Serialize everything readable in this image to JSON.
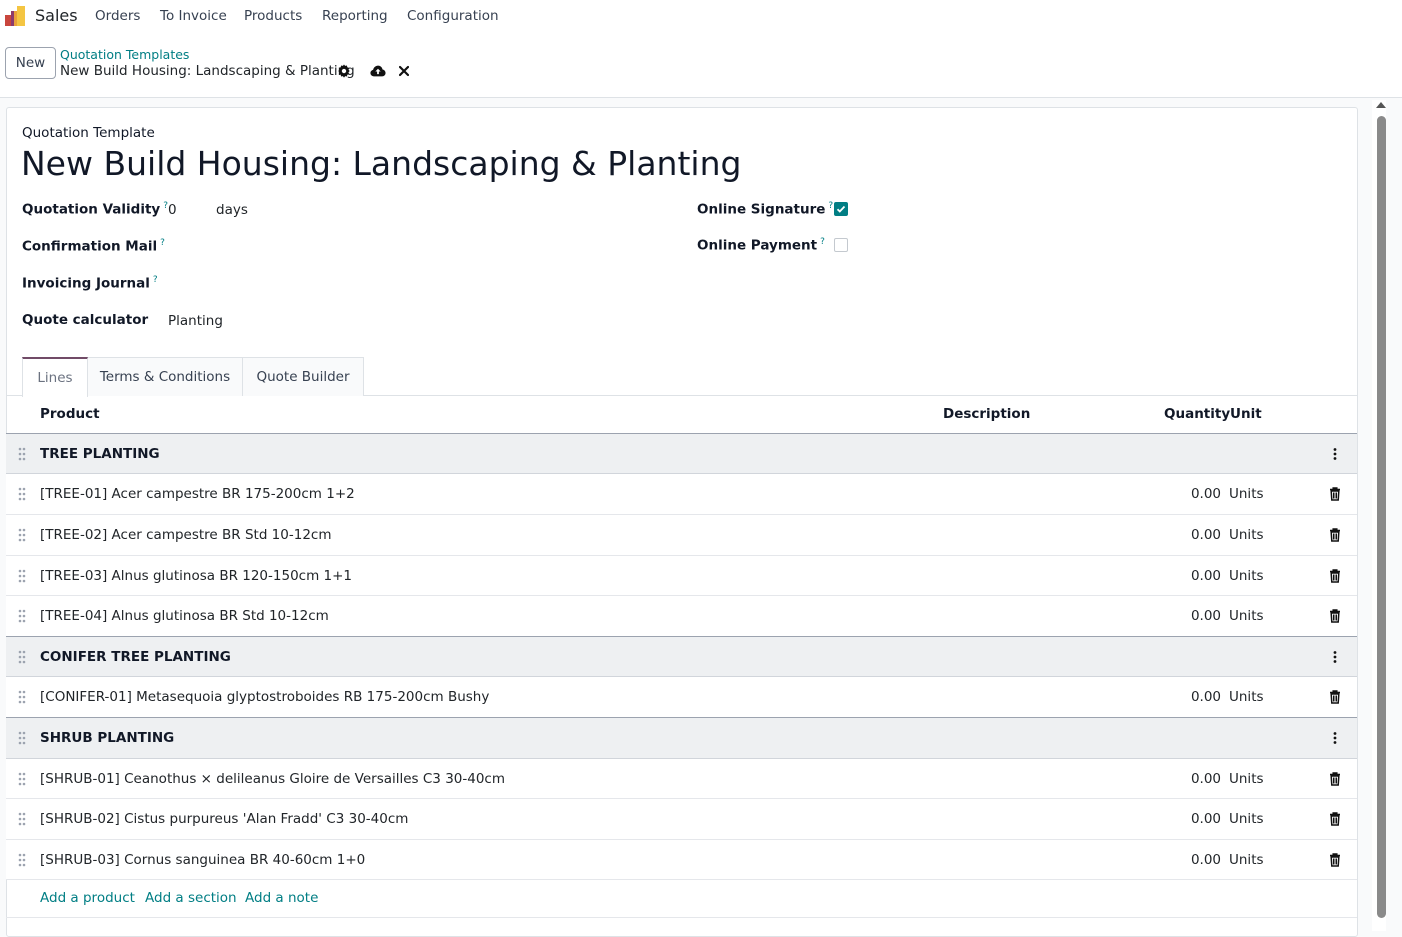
{
  "app": {
    "name": "Sales",
    "menu": [
      "Orders",
      "To Invoice",
      "Products",
      "Reporting",
      "Configuration"
    ]
  },
  "control": {
    "new_label": "New",
    "breadcrumb_parent": "Quotation Templates",
    "breadcrumb_current": "New Build Housing: Landscaping & Planting"
  },
  "form": {
    "caption": "Quotation Template",
    "title": "New Build Housing: Landscaping & Planting",
    "validity_label": "Quotation Validity",
    "validity_value": "0",
    "validity_unit": "days",
    "confirmation_mail_label": "Confirmation Mail",
    "invoicing_journal_label": "Invoicing Journal",
    "quote_calculator_label": "Quote calculator",
    "quote_calculator_value": "Planting",
    "online_signature_label": "Online Signature",
    "online_signature_checked": true,
    "online_payment_label": "Online Payment",
    "online_payment_checked": false,
    "help_mark": "?"
  },
  "tabs": [
    "Lines",
    "Terms & Conditions",
    "Quote Builder"
  ],
  "table": {
    "headers": {
      "product": "Product",
      "description": "Description",
      "quantity": "Quantity",
      "unit": "Unit"
    },
    "rows": [
      {
        "type": "section",
        "product": "TREE PLANTING"
      },
      {
        "type": "line",
        "product": "[TREE-01] Acer campestre BR 175-200cm 1+2",
        "qty": "0.00",
        "unit": "Units"
      },
      {
        "type": "line",
        "product": "[TREE-02] Acer campestre BR Std 10-12cm",
        "qty": "0.00",
        "unit": "Units"
      },
      {
        "type": "line",
        "product": "[TREE-03] Alnus glutinosa BR 120-150cm 1+1",
        "qty": "0.00",
        "unit": "Units"
      },
      {
        "type": "line",
        "product": "[TREE-04] Alnus glutinosa BR Std 10-12cm",
        "qty": "0.00",
        "unit": "Units"
      },
      {
        "type": "section",
        "product": "CONIFER TREE PLANTING"
      },
      {
        "type": "line",
        "product": "[CONIFER-01] Metasequoia glyptostroboides RB 175-200cm Bushy",
        "qty": "0.00",
        "unit": "Units"
      },
      {
        "type": "section",
        "product": "SHRUB PLANTING"
      },
      {
        "type": "line",
        "product": "[SHRUB-01] Ceanothus × delileanus Gloire de Versailles C3 30-40cm",
        "qty": "0.00",
        "unit": "Units"
      },
      {
        "type": "line",
        "product": "[SHRUB-02] Cistus purpureus 'Alan Fradd' C3 30-40cm",
        "qty": "0.00",
        "unit": "Units"
      },
      {
        "type": "line",
        "product": "[SHRUB-03] Cornus sanguinea BR 40-60cm 1+0",
        "qty": "0.00",
        "unit": "Units"
      }
    ]
  },
  "add_links": [
    "Add a product",
    "Add a section",
    "Add a note"
  ],
  "colors": {
    "accent": "#017e84",
    "brand": "#714b67"
  }
}
